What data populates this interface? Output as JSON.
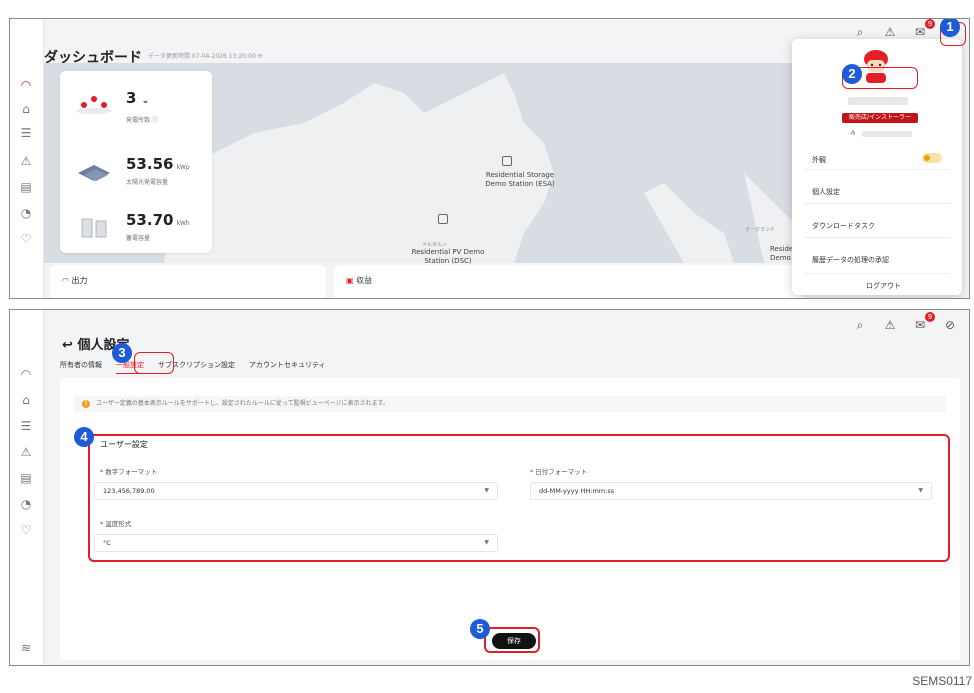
{
  "top": {
    "title": "ダッシュボード",
    "subtitle": "データ更新時間 07-04-2026 13:20:00",
    "sidebar_icons": [
      "gauge-icon",
      "home-icon",
      "devices-icon",
      "alarm-icon",
      "report-icon",
      "clock-icon",
      "heart-icon"
    ],
    "stats": {
      "station_count": "3",
      "station_label": "発電所数",
      "pv_capacity_value": "53.56",
      "pv_capacity_unit": "kWp",
      "pv_capacity_label": "太陽光発電容量",
      "storage_value": "53.70",
      "storage_unit": "kWh",
      "storage_label": "蓄電容量"
    },
    "map_labels": {
      "esa": "Residential Storage\nDemo Station (ESA)",
      "dsc": "Residential PV Demo\nStation (DSC)",
      "small": "メルボルン",
      "right_small": "オークランド",
      "resid": "Reside\nDemo S"
    },
    "bottom_cards": {
      "output": "出力",
      "revenue": "収益"
    },
    "dropdown": {
      "role": "販売店/インストーラー",
      "appearance": "外観",
      "personal_settings": "個人設定",
      "download_task": "ダウンロードタスク",
      "history_approval": "履歴データの処理の承認",
      "logout": "ログアウト"
    }
  },
  "bottom": {
    "page_title": "個人設定",
    "tabs": [
      "所有者の情報",
      "一般設定",
      "サブスクリプション設定",
      "アカウントセキュリティ"
    ],
    "notice": "ユーザー定義の基本表示ルールをサポートし、設定されたルールに従って監視ビューページに表示されます。",
    "section_title": "ユーザー設定",
    "number_format_label": "数字フォーマット",
    "number_format_value": "123,456,789.00",
    "date_format_label": "日付フォーマット",
    "date_format_value": "dd-MM-yyyy HH:mm:ss",
    "temperature_label": "温度形式",
    "temperature_value": "°C",
    "save_label": "保存"
  },
  "callouts": [
    "1",
    "2",
    "3",
    "4",
    "5"
  ],
  "footer_code": "SEMS0117",
  "colors": {
    "brand_red": "#e21f26",
    "callout_blue": "#1e5bd6"
  }
}
